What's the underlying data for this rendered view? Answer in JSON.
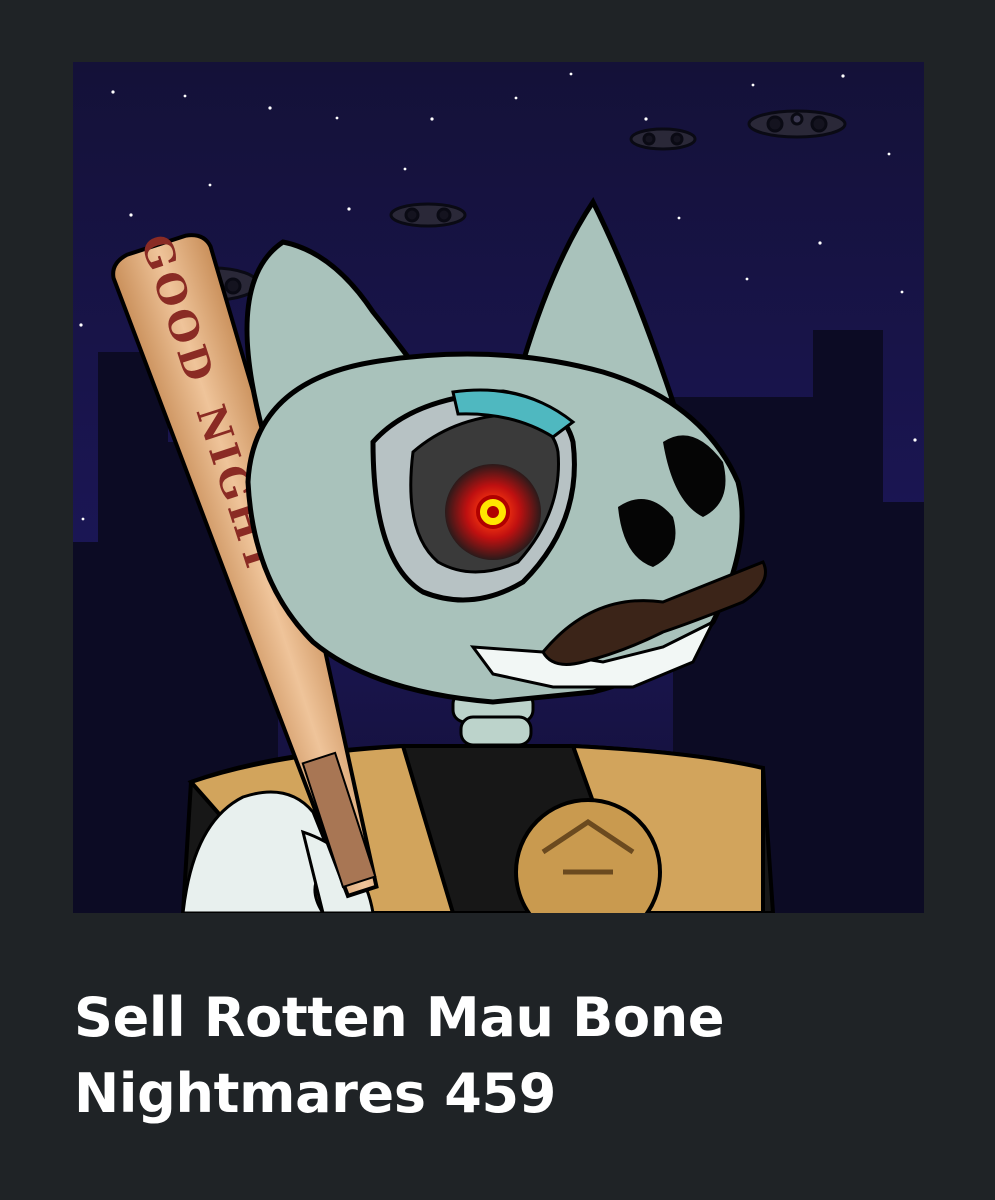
{
  "item": {
    "title": "Sell Rotten Mau Bone Nightmares 459",
    "artwork": {
      "subject": "skeleton-cat-with-bat",
      "bat_text_line1": "GOOD",
      "bat_text_line2": "NIGHT"
    }
  },
  "colors": {
    "page_background": "#1f2326",
    "title_text": "#ffffff",
    "sky": "#16134a",
    "eye_glow": "#ff2a1a"
  }
}
